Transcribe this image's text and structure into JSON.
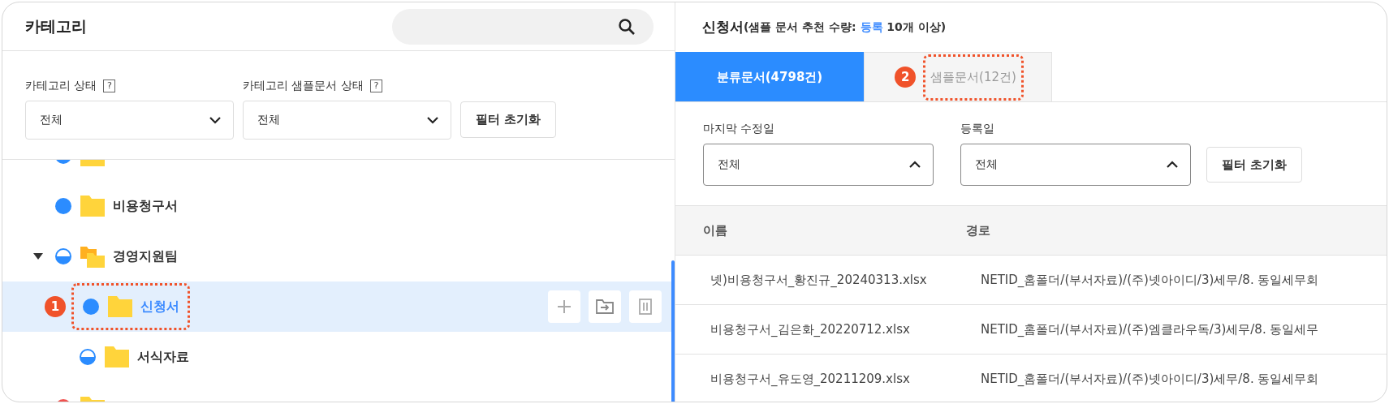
{
  "left": {
    "title": "카테고리",
    "filters": [
      {
        "label": "카테고리 상태",
        "help": "?",
        "value": "전체",
        "open": false
      },
      {
        "label": "카테고리 샘플문서 상태",
        "help": "?",
        "value": "전체",
        "open": false
      }
    ],
    "reset_button": "필터 초기화",
    "tree": [
      {
        "color": "#2b8cff",
        "selected": false
      },
      {
        "label": "비용청구서",
        "color": "#2b8cff",
        "partial": false,
        "selected": false
      },
      {
        "label": "경영지원팀",
        "color": "#2b8cff",
        "partial": true,
        "selected": false,
        "expanded": true,
        "children": [
          {
            "label": "신청서",
            "color": "#2b8cff",
            "partial": false,
            "selected": true,
            "callout": "1"
          },
          {
            "label": "서식자료",
            "color": "#2b8cff",
            "partial": true,
            "selected": false
          }
        ]
      },
      {
        "color": "#f0524f",
        "selected": false
      }
    ]
  },
  "right": {
    "title": "신청서",
    "note": "(샘플 문서 추천 수량: ",
    "note_link": "등록",
    "note_end": " 10개 이상)",
    "tabs": [
      {
        "label": "분류문서(4798건)",
        "selected": true
      },
      {
        "label": "샘플문서(12건)",
        "selected": false,
        "callout": "2"
      }
    ],
    "filters": [
      {
        "label": "마지막 수정일",
        "value": "전체",
        "open": true
      },
      {
        "label": "등록일",
        "value": "전체",
        "open": true
      }
    ],
    "reset_button": "필터 초기화",
    "table": {
      "columns": [
        "이름",
        "경로"
      ],
      "rows": [
        [
          "넷)비용청구서_황진규_20240313.xlsx",
          "NETID_홈폴더/(부서자료)/(주)넷아이디/3)세무/8. 동일세무회"
        ],
        [
          "비용청구서_김은화_20220712.xlsx",
          "NETID_홈폴더/(부서자료)/(주)엠클라우독/3)세무/8. 동일세무"
        ],
        [
          "비용청구서_유도영_20211209.xlsx",
          "NETID_홈폴더/(부서자료)/(주)넷아이디/3)세무/8. 동일세무회"
        ]
      ]
    }
  }
}
